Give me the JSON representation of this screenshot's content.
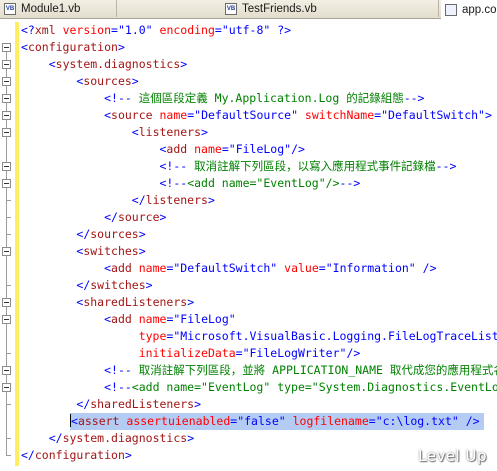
{
  "tabs": [
    {
      "label": "Module1.vb",
      "icon": "vb-file-icon"
    },
    {
      "label": "TestFriends.vb",
      "icon": "vb-file-icon"
    },
    {
      "label": "app.co",
      "icon": "config-file-icon"
    }
  ],
  "tab_icon_text": "VB",
  "code": [
    {
      "indent": 0,
      "tokens": [
        [
          "b",
          "<?"
        ],
        [
          "e",
          "xml"
        ],
        [
          "a",
          " version"
        ],
        [
          "b",
          "="
        ],
        [
          "v",
          "\"1.0\""
        ],
        [
          "a",
          " encoding"
        ],
        [
          "b",
          "="
        ],
        [
          "v",
          "\"utf-8\""
        ],
        [
          "b",
          " ?>"
        ]
      ]
    },
    {
      "indent": 0,
      "tokens": [
        [
          "b",
          "<"
        ],
        [
          "e",
          "configuration"
        ],
        [
          "b",
          ">"
        ]
      ]
    },
    {
      "indent": 4,
      "tokens": [
        [
          "b",
          "<"
        ],
        [
          "e",
          "system.diagnostics"
        ],
        [
          "b",
          ">"
        ]
      ]
    },
    {
      "indent": 8,
      "tokens": [
        [
          "b",
          "<"
        ],
        [
          "e",
          "sources"
        ],
        [
          "b",
          ">"
        ]
      ]
    },
    {
      "indent": 12,
      "tokens": [
        [
          "b",
          "<!--"
        ],
        [
          "c",
          " 這個區段定義 My.Application.Log 的記錄組態"
        ],
        [
          "b",
          "-->"
        ]
      ]
    },
    {
      "indent": 12,
      "tokens": [
        [
          "b",
          "<"
        ],
        [
          "e",
          "source"
        ],
        [
          "a",
          " name"
        ],
        [
          "b",
          "="
        ],
        [
          "v",
          "\"DefaultSource\""
        ],
        [
          "a",
          " switchName"
        ],
        [
          "b",
          "="
        ],
        [
          "v",
          "\"DefaultSwitch\""
        ],
        [
          "b",
          ">"
        ]
      ]
    },
    {
      "indent": 16,
      "tokens": [
        [
          "b",
          "<"
        ],
        [
          "e",
          "listeners"
        ],
        [
          "b",
          ">"
        ]
      ]
    },
    {
      "indent": 20,
      "tokens": [
        [
          "b",
          "<"
        ],
        [
          "e",
          "add"
        ],
        [
          "a",
          " name"
        ],
        [
          "b",
          "="
        ],
        [
          "v",
          "\"FileLog\""
        ],
        [
          "b",
          "/>"
        ]
      ]
    },
    {
      "indent": 20,
      "tokens": [
        [
          "b",
          "<!--"
        ],
        [
          "c",
          " 取消註解下列區段，以寫入應用程式事件記錄檔"
        ],
        [
          "b",
          "-->"
        ]
      ]
    },
    {
      "indent": 20,
      "tokens": [
        [
          "b",
          "<!--"
        ],
        [
          "c",
          "<add name=\"EventLog\"/>"
        ],
        [
          "b",
          "-->"
        ]
      ]
    },
    {
      "indent": 16,
      "tokens": [
        [
          "b",
          "</"
        ],
        [
          "e",
          "listeners"
        ],
        [
          "b",
          ">"
        ]
      ]
    },
    {
      "indent": 12,
      "tokens": [
        [
          "b",
          "</"
        ],
        [
          "e",
          "source"
        ],
        [
          "b",
          ">"
        ]
      ]
    },
    {
      "indent": 8,
      "tokens": [
        [
          "b",
          "</"
        ],
        [
          "e",
          "sources"
        ],
        [
          "b",
          ">"
        ]
      ]
    },
    {
      "indent": 8,
      "tokens": [
        [
          "b",
          "<"
        ],
        [
          "e",
          "switches"
        ],
        [
          "b",
          ">"
        ]
      ]
    },
    {
      "indent": 12,
      "tokens": [
        [
          "b",
          "<"
        ],
        [
          "e",
          "add"
        ],
        [
          "a",
          " name"
        ],
        [
          "b",
          "="
        ],
        [
          "v",
          "\"DefaultSwitch\""
        ],
        [
          "a",
          " value"
        ],
        [
          "b",
          "="
        ],
        [
          "v",
          "\"Information\""
        ],
        [
          "b",
          " />"
        ]
      ]
    },
    {
      "indent": 8,
      "tokens": [
        [
          "b",
          "</"
        ],
        [
          "e",
          "switches"
        ],
        [
          "b",
          ">"
        ]
      ]
    },
    {
      "indent": 8,
      "tokens": [
        [
          "b",
          "<"
        ],
        [
          "e",
          "sharedListeners"
        ],
        [
          "b",
          ">"
        ]
      ]
    },
    {
      "indent": 12,
      "tokens": [
        [
          "b",
          "<"
        ],
        [
          "e",
          "add"
        ],
        [
          "a",
          " name"
        ],
        [
          "b",
          "="
        ],
        [
          "v",
          "\"FileLog\""
        ]
      ]
    },
    {
      "indent": 17,
      "tokens": [
        [
          "a",
          "type"
        ],
        [
          "b",
          "="
        ],
        [
          "v",
          "\"Microsoft.VisualBasic.Logging.FileLogTraceListener\""
        ]
      ]
    },
    {
      "indent": 17,
      "tokens": [
        [
          "a",
          "initializeData"
        ],
        [
          "b",
          "="
        ],
        [
          "v",
          "\"FileLogWriter\""
        ],
        [
          "b",
          "/>"
        ]
      ]
    },
    {
      "indent": 12,
      "tokens": [
        [
          "b",
          "<!--"
        ],
        [
          "c",
          " 取消註解下列區段，並將 APPLICATION_NAME 取代成您的應用程式名稱"
        ],
        [
          "b",
          "-->"
        ]
      ]
    },
    {
      "indent": 12,
      "tokens": [
        [
          "b",
          "<!--"
        ],
        [
          "c",
          "<add name=\"EventLog\" type=\"System.Diagnostics.EventLogTraceListener\""
        ],
        [
          "b",
          "-->"
        ]
      ]
    },
    {
      "indent": 8,
      "tokens": [
        [
          "b",
          "</"
        ],
        [
          "e",
          "sharedListeners"
        ],
        [
          "b",
          ">"
        ]
      ]
    },
    {
      "indent": 6,
      "selected": true,
      "tokens": [
        [
          "b",
          "<"
        ],
        [
          "e",
          "assert"
        ],
        [
          "a",
          " assertuienabled"
        ],
        [
          "b",
          "="
        ],
        [
          "v",
          "\"false\""
        ],
        [
          "a",
          " logfilename"
        ],
        [
          "b",
          "="
        ],
        [
          "v",
          "\"c:\\log.txt\""
        ],
        [
          "b",
          " />"
        ]
      ]
    },
    {
      "indent": 4,
      "tokens": [
        [
          "b",
          "</"
        ],
        [
          "e",
          "system.diagnostics"
        ],
        [
          "b",
          ">"
        ]
      ]
    },
    {
      "indent": 0,
      "tokens": [
        [
          "b",
          "</"
        ],
        [
          "e",
          "configuration"
        ],
        [
          "b",
          ">"
        ]
      ]
    }
  ],
  "watermark": "Level Up"
}
